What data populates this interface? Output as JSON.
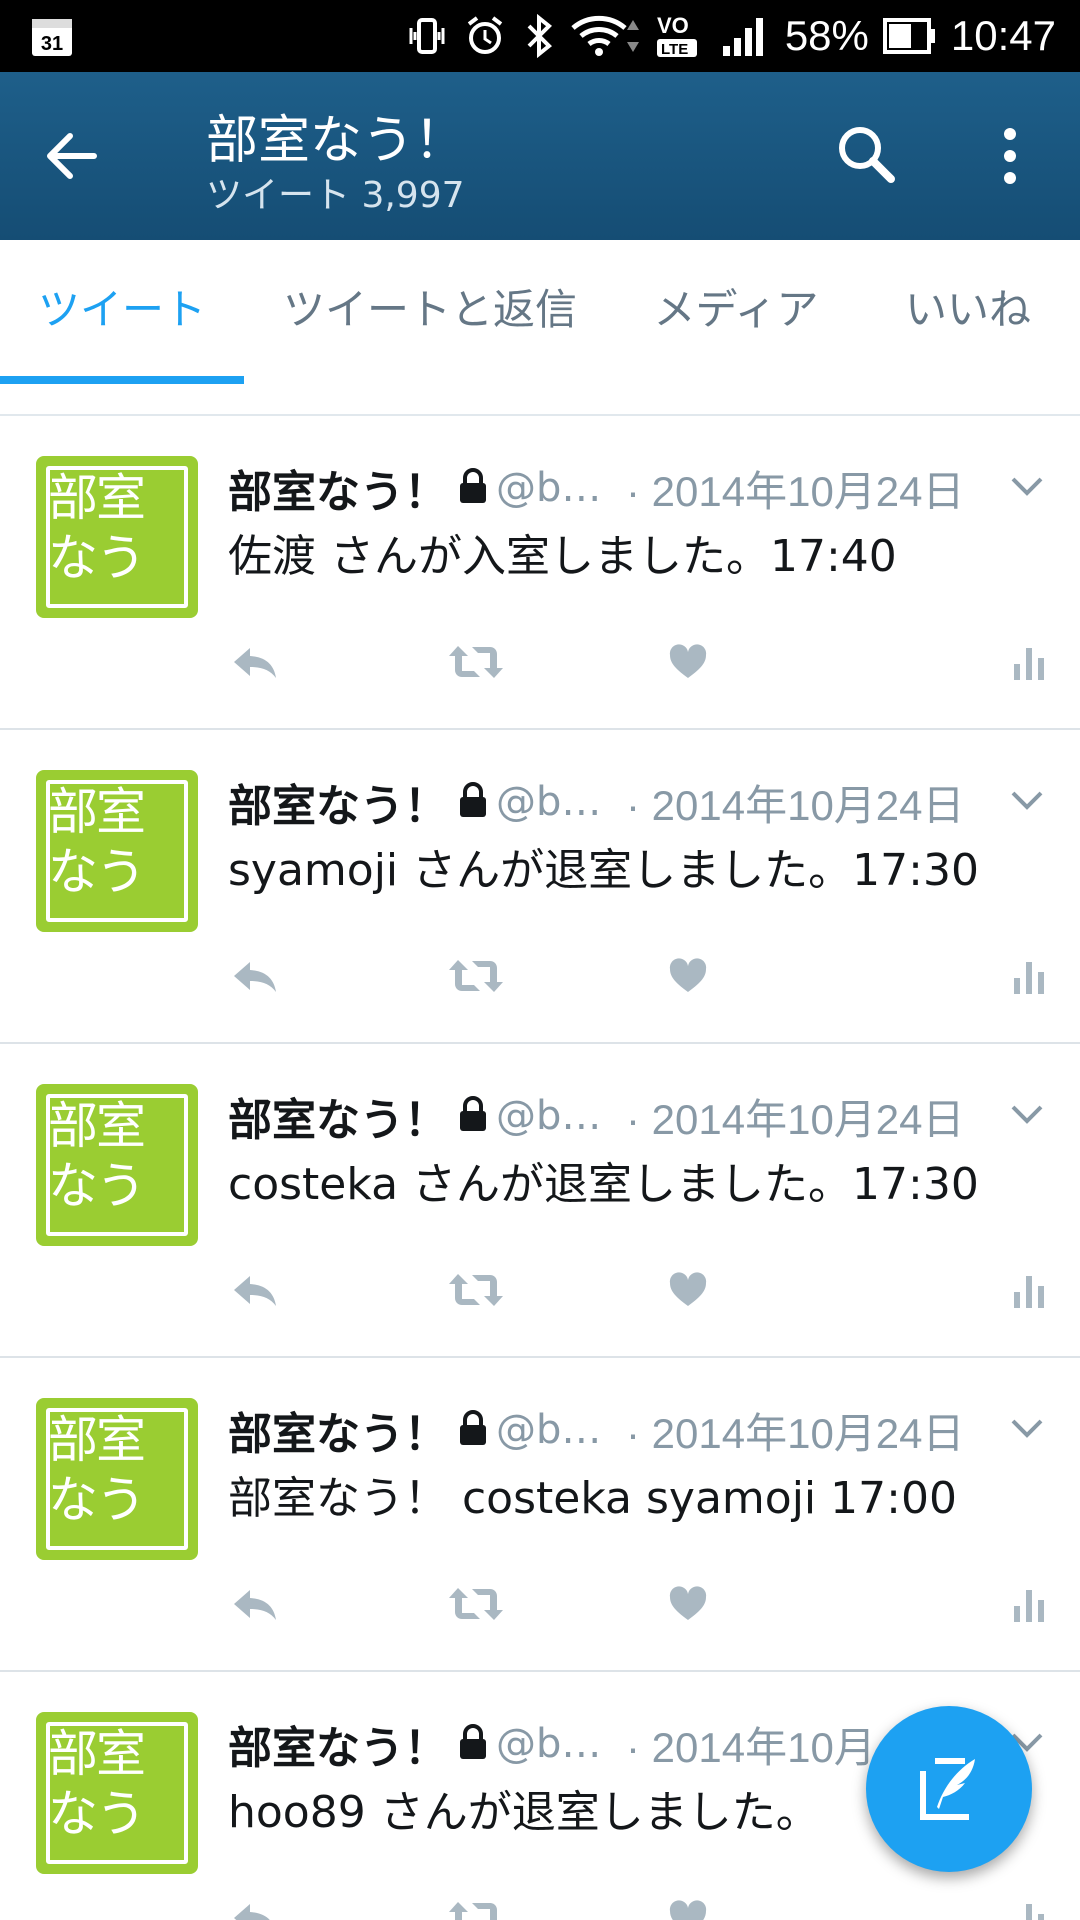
{
  "status_bar": {
    "calendar_day": "31",
    "battery_percent": "58%",
    "time": "10:47",
    "icons": [
      "calendar-icon",
      "vibrate-icon",
      "alarm-icon",
      "bluetooth-icon",
      "wifi-icon",
      "volte-icon",
      "signal-icon",
      "battery-icon"
    ]
  },
  "header": {
    "title": "部室なう！",
    "subtitle": "ツイート 3,997",
    "icons": [
      "back-arrow-icon",
      "search-icon",
      "more-vert-icon"
    ]
  },
  "tabs": [
    {
      "label": "ツイート",
      "active": true
    },
    {
      "label": "ツイートと返信",
      "active": false
    },
    {
      "label": "メディア",
      "active": false
    },
    {
      "label": "いいね",
      "active": false
    }
  ],
  "tweets": [
    {
      "name": "部室なう！",
      "handle": "@bu…",
      "date": "· 2014年10月24日",
      "text": "佐渡 さんが入室しました。17:40"
    },
    {
      "name": "部室なう！",
      "handle": "@bu…",
      "date": "· 2014年10月24日",
      "text": "syamoji さんが退室しました。17:30"
    },
    {
      "name": "部室なう！",
      "handle": "@bu…",
      "date": "· 2014年10月24日",
      "text": "costeka さんが退室しました。17:30"
    },
    {
      "name": "部室なう！",
      "handle": "@bu…",
      "date": "· 2014年10月24日",
      "text": "部室なう！ costeka syamoji 17:00"
    },
    {
      "name": "部室なう！",
      "handle": "@bu…",
      "date": "· 2014年10月",
      "text": "hoo89 さんが退室しました。"
    }
  ],
  "avatar_text": "部室\nなう",
  "colors": {
    "accent": "#1da1f2",
    "header": "#1a5680",
    "avatar": "#9acd32",
    "muted": "#8899a6"
  },
  "fab": {
    "icon": "compose-tweet-icon"
  }
}
